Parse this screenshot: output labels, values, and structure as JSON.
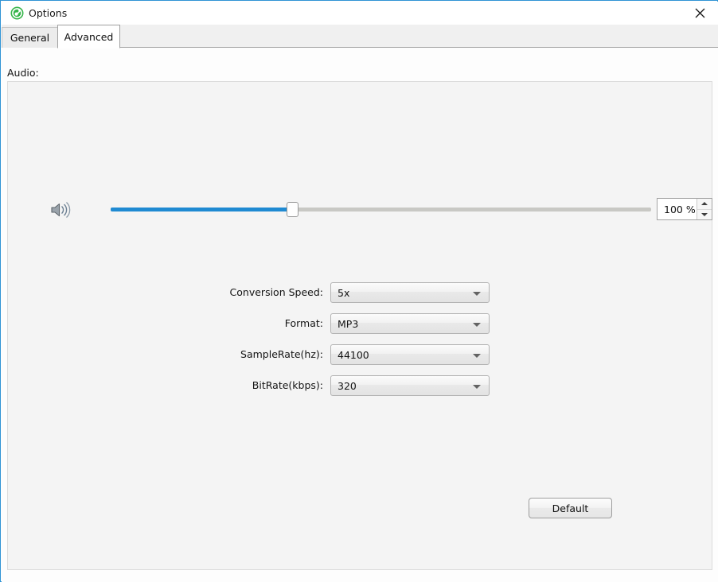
{
  "window": {
    "title": "Options",
    "app_icon": "green-circle-logo-icon",
    "close_label": "✕",
    "accent_color": "#2f93d4"
  },
  "tabs": [
    {
      "id": "general",
      "label": "General",
      "active": false
    },
    {
      "id": "advanced",
      "label": "Advanced",
      "active": true
    }
  ],
  "content": {
    "section_label": "Audio:",
    "volume": {
      "icon": "speaker-volume-icon",
      "value": "100 %",
      "slider_fill_percent": 33.7,
      "fill_color": "#1f8ad2",
      "track_color": "#c8c8c4",
      "spin_up": "▲",
      "spin_down": "▼"
    },
    "fields": [
      {
        "id": "conversion-speed",
        "label": "Conversion Speed:",
        "value": "5x"
      },
      {
        "id": "format",
        "label": "Format:",
        "value": "MP3"
      },
      {
        "id": "samplerate",
        "label": "SampleRate(hz):",
        "value": "44100"
      },
      {
        "id": "bitrate",
        "label": "BitRate(kbps):",
        "value": "320"
      }
    ],
    "default_button": "Default"
  }
}
